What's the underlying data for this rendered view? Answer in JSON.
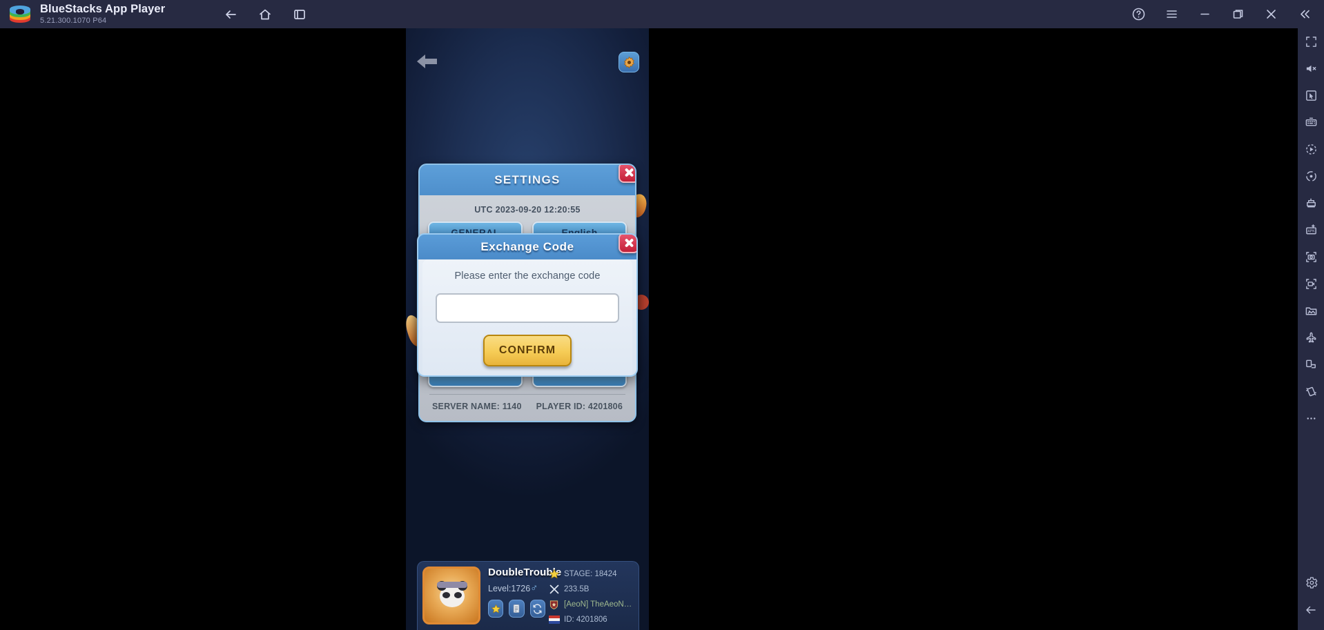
{
  "titlebar": {
    "app_name": "BlueStacks App Player",
    "version": "5.21.300.1070  P64",
    "logo_icon": "bluestacks-logo",
    "nav": [
      {
        "name": "back",
        "icon": "arrow-left-icon"
      },
      {
        "name": "home",
        "icon": "home-icon"
      },
      {
        "name": "recents",
        "icon": "recents-icon"
      }
    ],
    "window_controls": [
      {
        "name": "help",
        "icon": "help-circle-icon"
      },
      {
        "name": "menu",
        "icon": "hamburger-menu-icon"
      },
      {
        "name": "minimize",
        "icon": "minimize-icon"
      },
      {
        "name": "maximize",
        "icon": "restore-window-icon"
      },
      {
        "name": "close",
        "icon": "close-icon"
      },
      {
        "name": "collapse-sidebar",
        "icon": "chevron-double-left-icon"
      }
    ]
  },
  "game": {
    "back_icon": "back-arrow-icon",
    "gear_icon": "gear-icon",
    "settings_panel": {
      "title": "SETTINGS",
      "utc_time": "UTC 2023-09-20 12:20:55",
      "general_label": "GENERAL",
      "language_label": "English",
      "server_name": "SERVER NAME: 1140",
      "player_id": "PLAYER ID: 4201806",
      "close_icon": "close-icon"
    },
    "exchange_dialog": {
      "title": "Exchange Code",
      "prompt": "Please enter the exchange code",
      "input_value": "",
      "input_placeholder": "",
      "confirm_label": "CONFIRM",
      "close_icon": "close-icon"
    },
    "player": {
      "avatar_icon": "panda-avatar",
      "name": "DoubleTrouble",
      "edit_icon": "pencil-icon",
      "level": "Level:1726",
      "gender_icon": "male-symbol",
      "buttons": [
        {
          "name": "star-button",
          "icon": "star-icon"
        },
        {
          "name": "records-button",
          "icon": "document-icon"
        },
        {
          "name": "switch-button",
          "icon": "refresh-icon"
        }
      ],
      "stats": [
        {
          "icon": "star-icon",
          "text": "STAGE: 18424"
        },
        {
          "icon": "crossed-swords-icon",
          "text": "233.5B"
        },
        {
          "icon": "guild-crest-icon",
          "text": "[AeoN] TheAeoNKings",
          "guild": true
        },
        {
          "icon": "flag-icon",
          "text": "ID: 4201806"
        }
      ]
    }
  },
  "sidebar": {
    "top_icons": [
      {
        "name": "fullscreen",
        "icon": "fullscreen-icon"
      },
      {
        "name": "mute",
        "icon": "speaker-mute-icon"
      },
      {
        "name": "cursor-control",
        "icon": "cursor-icon"
      },
      {
        "name": "keymapping",
        "icon": "keyboard-icon"
      },
      {
        "name": "macro-recorder",
        "icon": "play-macro-icon"
      },
      {
        "name": "rotate-control",
        "icon": "orbit-icon"
      },
      {
        "name": "multi-instance",
        "icon": "multi-instance-icon"
      },
      {
        "name": "install-apk",
        "icon": "apk-install-icon"
      },
      {
        "name": "screenshot",
        "icon": "camera-icon"
      },
      {
        "name": "record-screen",
        "icon": "video-record-icon"
      },
      {
        "name": "media-manager",
        "icon": "media-folder-icon"
      },
      {
        "name": "eco-mode",
        "icon": "airplane-icon"
      },
      {
        "name": "rotate-screen",
        "icon": "rotate-screen-icon"
      },
      {
        "name": "shake",
        "icon": "shake-icon"
      },
      {
        "name": "more",
        "icon": "more-dots-icon"
      }
    ],
    "bottom_icons": [
      {
        "name": "settings",
        "icon": "gear-icon"
      },
      {
        "name": "collapse",
        "icon": "arrow-left-icon"
      }
    ]
  },
  "colors": {
    "titlebar_bg": "#272a42",
    "dialog_header": "#4b8bc9",
    "confirm_button": "#f6cd58",
    "close_button": "#c32038",
    "avatar_border": "#e08a34"
  }
}
